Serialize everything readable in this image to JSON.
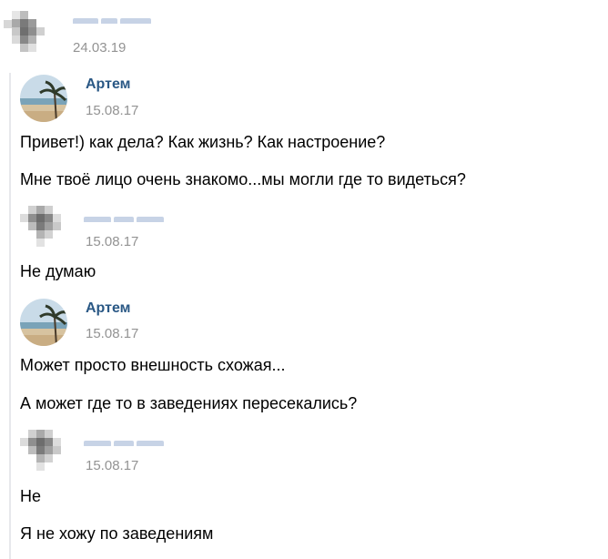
{
  "forwarded": {
    "date": "24.03.19"
  },
  "messages": [
    {
      "author": "Артем",
      "date": "15.08.17",
      "lines": [
        "Привет!) как дела? Как жизнь? Как настроение?",
        "Мне твоё лицо очень знакомо...мы могли где то видеться?"
      ]
    },
    {
      "author": "",
      "date": "15.08.17",
      "lines": [
        "Не думаю"
      ]
    },
    {
      "author": "Артем",
      "date": "15.08.17",
      "lines": [
        "Может просто внешность схожая...",
        "А может где то в заведениях пересекались?"
      ]
    },
    {
      "author": "",
      "date": "15.08.17",
      "lines": [
        "Не",
        "Я не хожу по заведениям"
      ]
    }
  ],
  "colors": {
    "author_link": "#2a5885",
    "date": "#939393",
    "quote_bar": "#e7e8ec",
    "blur_name": "#c7d3e6"
  },
  "icons": {
    "blurred_avatar": "pixelated-avatar-icon",
    "artem_avatar": "beach-palm-photo"
  }
}
